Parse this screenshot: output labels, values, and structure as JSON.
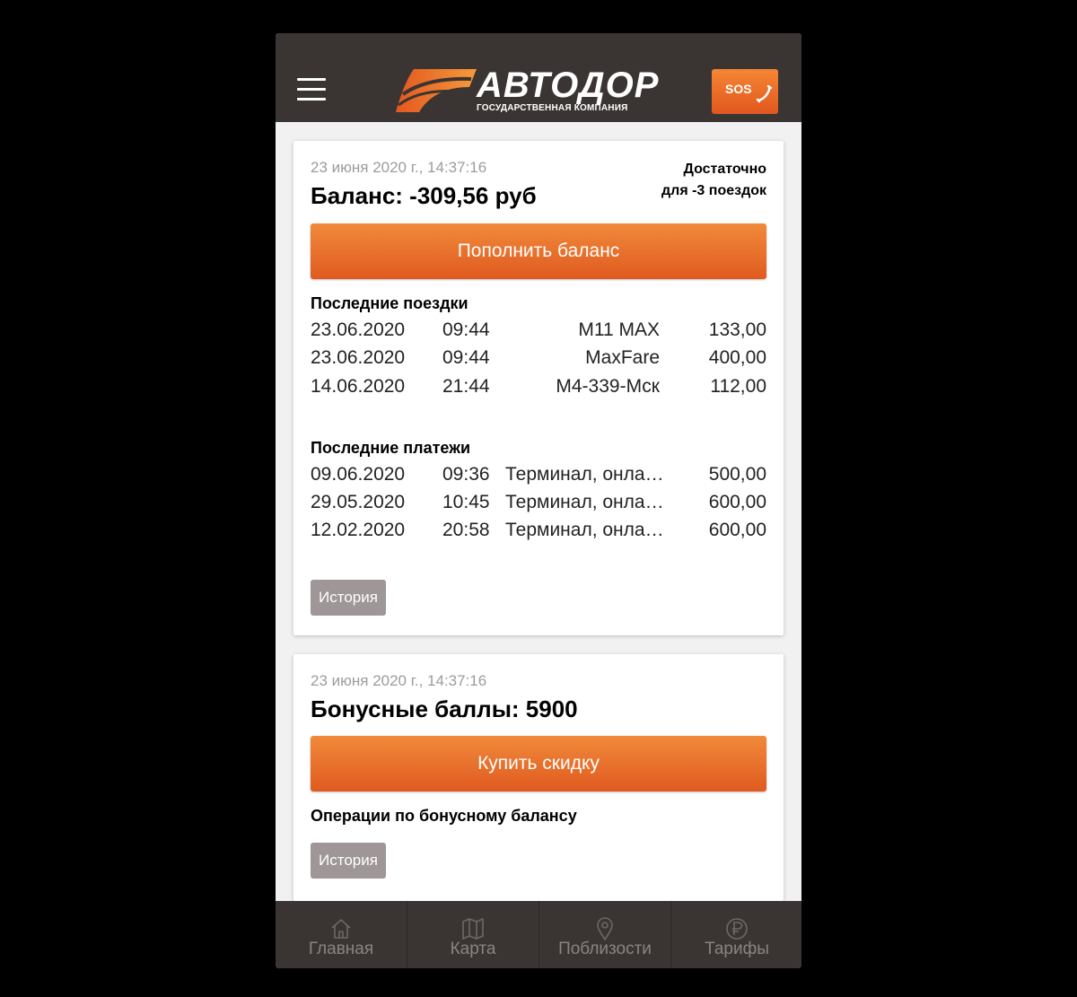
{
  "header": {
    "logo_text": "АВТОДОР",
    "logo_subtitle": "ГОСУДАРСТВЕННАЯ КОМПАНИЯ",
    "sos_label": "SOS"
  },
  "balance_card": {
    "timestamp": "23 июня 2020 г., 14:37:16",
    "title": "Баланс: -309,56 руб",
    "enough_line1": "Достаточно",
    "enough_line2": "для -3 поездок",
    "topup_label": "Пополнить баланс",
    "trips_title": "Последние поездки",
    "trips": [
      {
        "date": "23.06.2020",
        "time": "09:44",
        "route": "M11 MAX",
        "amount": "133,00"
      },
      {
        "date": "23.06.2020",
        "time": "09:44",
        "route": "MaxFare",
        "amount": "400,00"
      },
      {
        "date": "14.06.2020",
        "time": "21:44",
        "route": "M4-339-Мск",
        "amount": "112,00"
      }
    ],
    "payments_title": "Последние платежи",
    "payments": [
      {
        "date": "09.06.2020",
        "time": "09:36",
        "source": "Терминал, онлайн",
        "amount": "500,00"
      },
      {
        "date": "29.05.2020",
        "time": "10:45",
        "source": "Терминал, онлайн",
        "amount": "600,00"
      },
      {
        "date": "12.02.2020",
        "time": "20:58",
        "source": "Терминал, онлайн",
        "amount": "600,00"
      }
    ],
    "history_label": "История"
  },
  "bonus_card": {
    "timestamp": "23 июня 2020 г., 14:37:16",
    "title": "Бонусные баллы: 5900",
    "buy_label": "Купить скидку",
    "operations_title": "Операции по бонусному балансу",
    "history_label": "История"
  },
  "tabbar": {
    "tabs": [
      {
        "label": "Главная",
        "icon": "home-icon"
      },
      {
        "label": "Карта",
        "icon": "map-icon"
      },
      {
        "label": "Поблизости",
        "icon": "location-pin-icon"
      },
      {
        "label": "Тарифы",
        "icon": "ruble-icon"
      }
    ]
  },
  "colors": {
    "accent_orange": "#e8692b",
    "header_bg": "#3a3533",
    "secondary_button": "#9f9697"
  }
}
